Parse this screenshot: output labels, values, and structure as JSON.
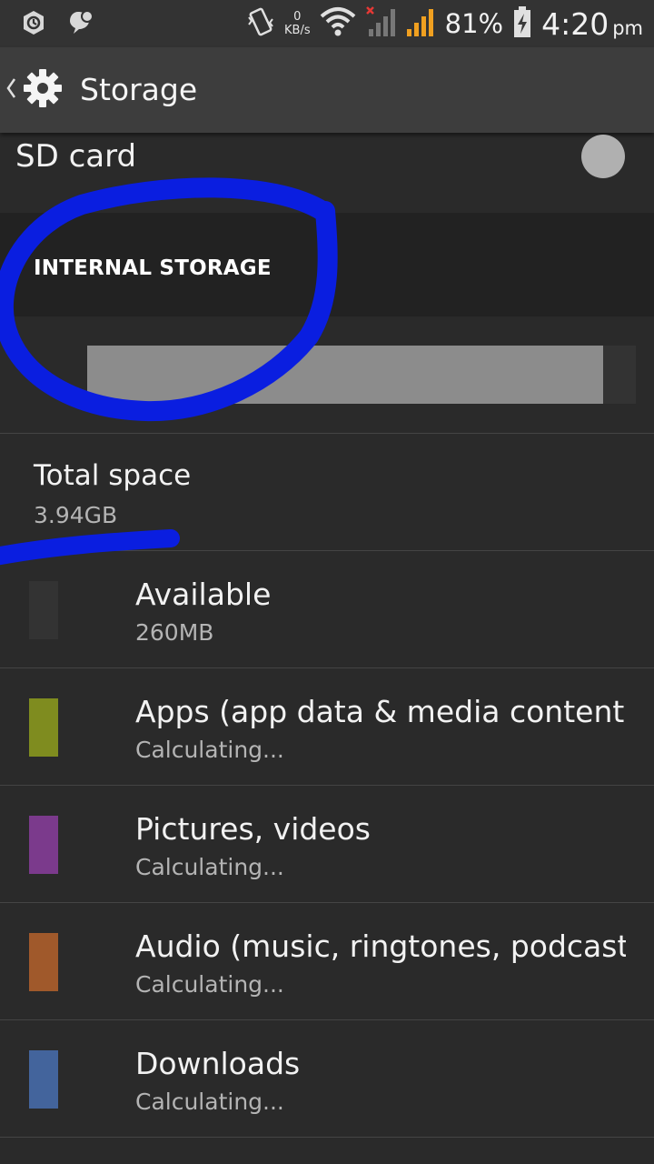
{
  "status_bar": {
    "kbs_value": "0",
    "kbs_unit": "KB/s",
    "battery_percent": "81%",
    "time": "4:20",
    "ampm": "pm",
    "icons": [
      "sync-icon",
      "chat-icon",
      "vibrate-icon",
      "wifi-icon",
      "signal-sim1-icon",
      "signal-sim2-icon",
      "battery-charging-icon"
    ]
  },
  "action_bar": {
    "title": "Storage",
    "icons": [
      "back-chevron-icon",
      "gear-icon"
    ]
  },
  "sd_card": {
    "label": "SD card"
  },
  "internal_storage": {
    "header": "INTERNAL STORAGE",
    "usage_fraction_used": 0.94
  },
  "total_space": {
    "label": "Total space",
    "value": "3.94GB"
  },
  "items": [
    {
      "title": "Available",
      "subtitle": "260MB",
      "color": "#333333"
    },
    {
      "title": "Apps (app data & media content)",
      "subtitle": "Calculating...",
      "color": "#7f8c1f"
    },
    {
      "title": "Pictures, videos",
      "subtitle": "Calculating...",
      "color": "#7b3a8c"
    },
    {
      "title": "Audio (music, ringtones, podcasts, etc.)",
      "subtitle": "Calculating...",
      "color": "#a0592b"
    },
    {
      "title": "Downloads",
      "subtitle": "Calculating...",
      "color": "#43649c"
    }
  ],
  "colors": {
    "background": "#2a2a2a",
    "action_bar": "#3d3d3d",
    "section_header": "#222222",
    "usage_used": "#8c8c8c",
    "annotation": "#0a1ee0"
  }
}
